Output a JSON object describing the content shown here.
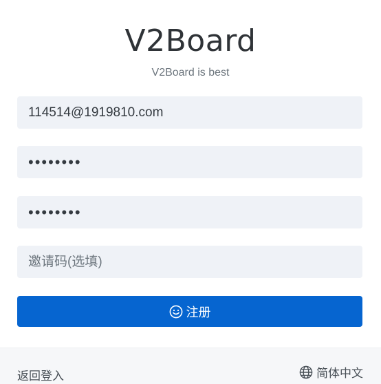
{
  "header": {
    "title": "V2Board",
    "subtitle": "V2Board is best"
  },
  "form": {
    "email_value": "114514@1919810.com",
    "password_value": "********",
    "password_confirm_value": "********",
    "invite_placeholder": "邀请码(选填)",
    "invite_value": "",
    "submit_label": "注册",
    "submit_icon": "smile-icon"
  },
  "footer": {
    "back_link": "返回登入",
    "language_label": "简体中文",
    "language_icon": "globe-icon"
  },
  "colors": {
    "primary": "#0665d0",
    "field_bg": "#eff2f7",
    "footer_bg": "#f6f7f9"
  }
}
